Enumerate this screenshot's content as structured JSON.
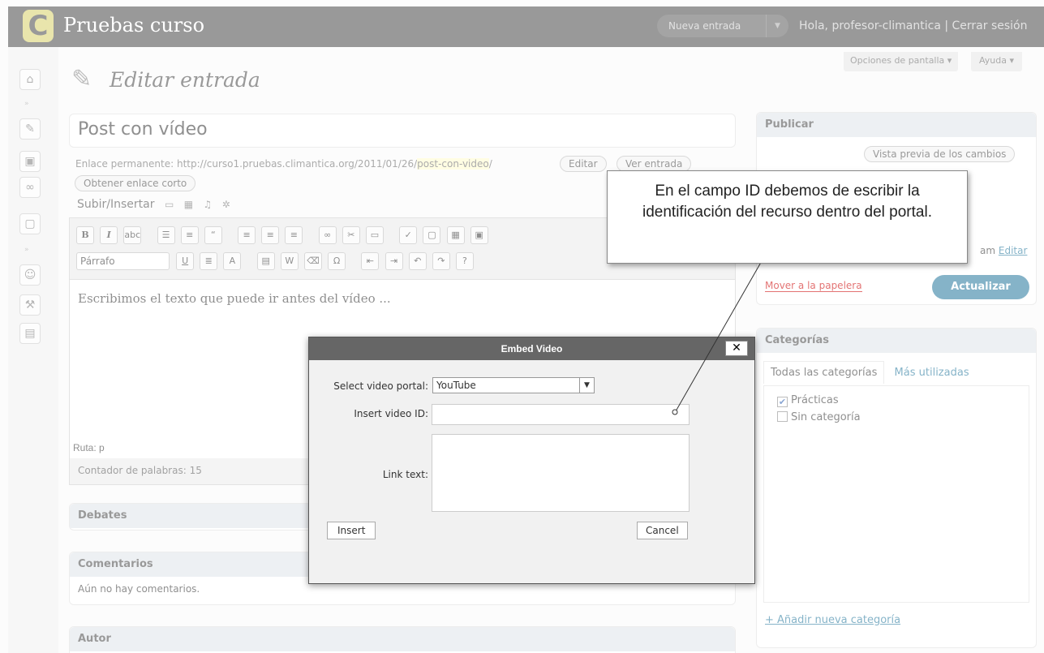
{
  "header": {
    "logo_letter": "C",
    "site_title": "Pruebas curso",
    "new_entry_label": "Nueva entrada",
    "greeting": "Hola, profesor-climantica | Cerrar sesión"
  },
  "screen_options": {
    "options_label": "Opciones de pantalla ▾",
    "help_label": "Ayuda ▾"
  },
  "page": {
    "title": "Editar entrada"
  },
  "post": {
    "title": "Post con vídeo",
    "permalink_prefix": "Enlace permanente: http://curso1.pruebas.climantica.org/2011/01/26/",
    "permalink_slug": "post-con-video",
    "permalink_suffix": "/",
    "edit_label": "Editar",
    "view_label": "Ver entrada",
    "shortlink_label": "Obtener enlace corto",
    "upload_label": "Subir/Insertar",
    "body_text": "Escribimos el texto que puede ir antes del vídeo ...",
    "format_select": "Párrafo",
    "path": "Ruta: p",
    "word_count": "Contador de palabras: 15"
  },
  "boxes": {
    "debates": "Debates",
    "comments": "Comentarios",
    "no_comments": "Aún no hay comentarios.",
    "author": "Autor"
  },
  "publish": {
    "title": "Publicar",
    "preview_label": "Vista previa de los cambios",
    "status_fragment": "am",
    "status_edit": "Editar",
    "trash_label": "Mover a la papelera",
    "update_label": "Actualizar"
  },
  "categories": {
    "title": "Categorías",
    "tab_all": "Todas las categorías",
    "tab_most": "Más utilizadas",
    "items": [
      {
        "label": "Prácticas",
        "checked": true
      },
      {
        "label": "Sin categoría",
        "checked": false
      }
    ],
    "add_label": "+ Añadir nueva categoría"
  },
  "dialog": {
    "title": "Embed Video",
    "close_label": "✕",
    "portal_label": "Select video portal:",
    "portal_value": "YouTube",
    "id_label": "Insert video ID:",
    "id_value": "",
    "link_label": "Link text:",
    "link_value": "",
    "insert_label": "Insert",
    "cancel_label": "Cancel"
  },
  "callout": {
    "text": "En el campo ID debemos de escribir la identificación del recurso dentro del portal."
  }
}
